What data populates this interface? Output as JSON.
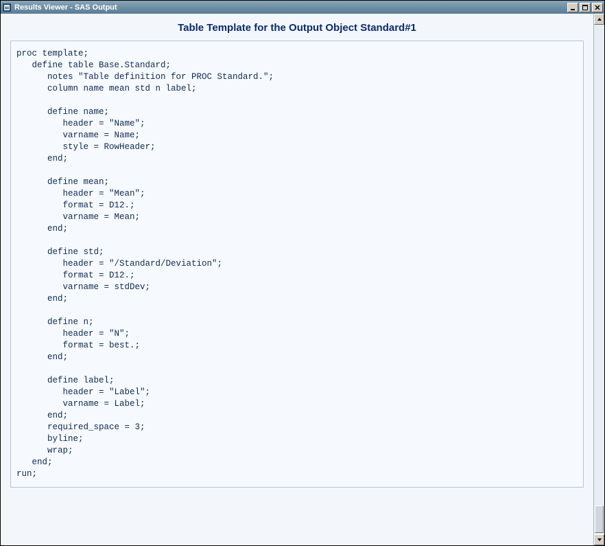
{
  "window": {
    "title": "Results Viewer - SAS Output"
  },
  "heading": "Table Template for the Output Object Standard#1",
  "code_lines": [
    "proc template;",
    "   define table Base.Standard;",
    "      notes \"Table definition for PROC Standard.\";",
    "      column name mean std n label;",
    "",
    "      define name;",
    "         header = \"Name\";",
    "         varname = Name;",
    "         style = RowHeader;",
    "      end;",
    "",
    "      define mean;",
    "         header = \"Mean\";",
    "         format = D12.;",
    "         varname = Mean;",
    "      end;",
    "",
    "      define std;",
    "         header = \"/Standard/Deviation\";",
    "         format = D12.;",
    "         varname = stdDev;",
    "      end;",
    "",
    "      define n;",
    "         header = \"N\";",
    "         format = best.;",
    "      end;",
    "",
    "      define label;",
    "         header = \"Label\";",
    "         varname = Label;",
    "      end;",
    "      required_space = 3;",
    "      byline;",
    "      wrap;",
    "   end;",
    "run;"
  ]
}
